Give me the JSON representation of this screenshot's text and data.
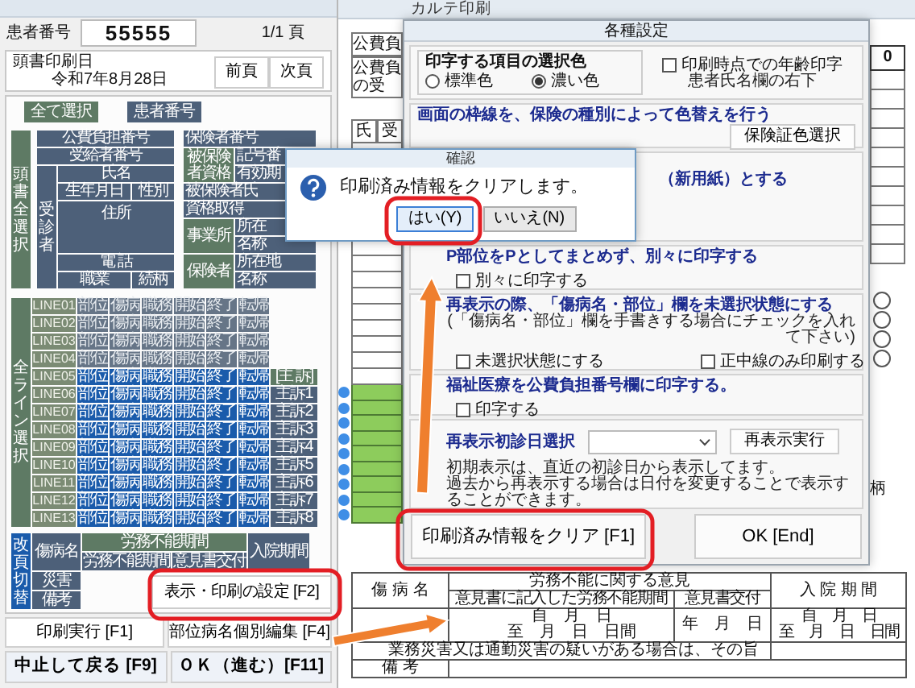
{
  "left_window": {
    "patient_label": "患者番号",
    "patient_number": "55555",
    "page": "1/1 頁",
    "print_date_label": "頭書印刷日",
    "print_date": "令和7年8月28日",
    "page_buttons": [
      "前頁",
      "次頁"
    ],
    "select_buttons": [
      {
        "label": "全て選択",
        "kind": "green"
      },
      {
        "label": "患者番号",
        "kind": "slate"
      }
    ],
    "header_group": {
      "label": "頭書全選択",
      "items": [
        {
          "text": "公費負担番号",
          "kind": "item"
        },
        {
          "text": "受給者番号",
          "kind": "item"
        },
        {
          "text": "受診者",
          "kind": "vertical"
        },
        {
          "text": "氏名",
          "kind": "item"
        },
        {
          "text": "生年月日",
          "kind": "item"
        },
        {
          "text": "性別",
          "kind": "item"
        },
        {
          "text": "住所",
          "kind": "item"
        },
        {
          "text": "電 話",
          "kind": "item"
        },
        {
          "text": "職業",
          "kind": "item"
        },
        {
          "text": "続柄",
          "kind": "item"
        },
        {
          "text": "保険者番号",
          "kind": "item"
        },
        {
          "text": "被保険者資格",
          "kind": "group"
        },
        {
          "text": "記号番",
          "kind": "item"
        },
        {
          "text": "有効期",
          "kind": "item"
        },
        {
          "text": "被保険者氏",
          "kind": "item"
        },
        {
          "text": "資格取得",
          "kind": "item"
        },
        {
          "text": "事業所",
          "kind": "group"
        },
        {
          "text": "所在",
          "kind": "item"
        },
        {
          "text": "名称",
          "kind": "item"
        },
        {
          "text": "保険者",
          "kind": "group"
        },
        {
          "text": "所在地",
          "kind": "item"
        },
        {
          "text": "名称",
          "kind": "item"
        }
      ]
    },
    "lines_group": {
      "label": "全ライン選択",
      "lines": [
        {
          "label": "LINE01",
          "selected": false,
          "cells": [
            "部位",
            "傷病",
            "職務",
            "開始",
            "終了",
            "転帰"
          ]
        },
        {
          "label": "LINE02",
          "selected": false,
          "cells": [
            "部位",
            "傷病",
            "職務",
            "開始",
            "終了",
            "転帰"
          ]
        },
        {
          "label": "LINE03",
          "selected": false,
          "cells": [
            "部位",
            "傷病",
            "職務",
            "開始",
            "終了",
            "転帰"
          ]
        },
        {
          "label": "LINE04",
          "selected": false,
          "cells": [
            "部位",
            "傷病",
            "職務",
            "開始",
            "終了",
            "転帰"
          ]
        },
        {
          "label": "LINE05",
          "selected": true,
          "cells": [
            "部位",
            "傷病",
            "職務",
            "開始",
            "終了",
            "転帰"
          ],
          "complaint": {
            "text": "[主 訴]",
            "kind": "group"
          }
        },
        {
          "label": "LINE06",
          "selected": true,
          "cells": [
            "部位",
            "傷病",
            "職務",
            "開始",
            "終了",
            "転帰"
          ],
          "complaint": {
            "text": "主訴1",
            "kind": "item"
          }
        },
        {
          "label": "LINE07",
          "selected": true,
          "cells": [
            "部位",
            "傷病",
            "職務",
            "開始",
            "終了",
            "転帰"
          ],
          "complaint": {
            "text": "主訴2",
            "kind": "item"
          }
        },
        {
          "label": "LINE08",
          "selected": true,
          "cells": [
            "部位",
            "傷病",
            "職務",
            "開始",
            "終了",
            "転帰"
          ],
          "complaint": {
            "text": "主訴3",
            "kind": "item"
          }
        },
        {
          "label": "LINE09",
          "selected": true,
          "cells": [
            "部位",
            "傷病",
            "職務",
            "開始",
            "終了",
            "転帰"
          ],
          "complaint": {
            "text": "主訴4",
            "kind": "item"
          }
        },
        {
          "label": "LINE10",
          "selected": true,
          "cells": [
            "部位",
            "傷病",
            "職務",
            "開始",
            "終了",
            "転帰"
          ],
          "complaint": {
            "text": "主訴5",
            "kind": "item"
          }
        },
        {
          "label": "LINE11",
          "selected": true,
          "cells": [
            "部位",
            "傷病",
            "職務",
            "開始",
            "終了",
            "転帰"
          ],
          "complaint": {
            "text": "主訴6",
            "kind": "item"
          }
        },
        {
          "label": "LINE12",
          "selected": true,
          "cells": [
            "部位",
            "傷病",
            "職務",
            "開始",
            "終了",
            "転帰"
          ],
          "complaint": {
            "text": "主訴7",
            "kind": "item"
          }
        },
        {
          "label": "LINE13",
          "selected": true,
          "cells": [
            "部位",
            "傷病",
            "職務",
            "開始",
            "終了",
            "転帰"
          ],
          "complaint": {
            "text": "主訴8",
            "kind": "item"
          }
        }
      ]
    },
    "page_break": {
      "label": "改頁切替",
      "selected": true
    },
    "bottom_items": [
      {
        "text": "傷病名",
        "kind": "item"
      },
      {
        "text": "災害",
        "kind": "item"
      },
      {
        "text": "備考",
        "kind": "item"
      },
      {
        "text": "労務不能期間",
        "kind": "group"
      },
      {
        "text": "労務不能期間",
        "kind": "item"
      },
      {
        "text": "意見書交付",
        "kind": "item"
      },
      {
        "text": "入院期間",
        "kind": "item"
      }
    ],
    "settings_button": "表示・印刷の設定 [F2]",
    "actions": [
      {
        "label": "印刷実行 [F1]",
        "kind": "plain"
      },
      {
        "label": "部位病名個別編集 [F4]",
        "kind": "plain"
      },
      {
        "label": "中止して戻る [F9]",
        "kind": "bold"
      },
      {
        "label": "ＯＫ（進む）[F11]",
        "kind": "bold"
      }
    ]
  },
  "preview": {
    "title": "カルテ印刷",
    "left_cells": [
      [
        "公費負"
      ],
      [
        "公費負",
        "の受"
      ]
    ],
    "side_cells": [
      "氏",
      "受"
    ],
    "right_value": "0",
    "right_label": "柄",
    "table": {
      "disease_header": "傷 病 名",
      "opinion_header": "労務不能に関する意見",
      "admission_header": "入 院 期 間",
      "opinion_columns": [
        "意見書に記入した労務不能期間",
        "意見書交付"
      ],
      "period": [
        "自　月　日",
        "至　月　日　日間"
      ],
      "issue_date": "年　月　日",
      "admission": [
        "自　月　日",
        "至　月　日　日間"
      ],
      "note": "業務災害又は通勤災害の疑いがある場合は、その旨",
      "remarks_label": "備 考"
    }
  },
  "settings": {
    "title": "各種設定",
    "color_group": {
      "label": "印字する項目の選択色",
      "options": [
        {
          "label": "標準色",
          "selected": false
        },
        {
          "label": "濃い色",
          "selected": true
        }
      ]
    },
    "age_option": {
      "label": "印刷時点での年齢印字",
      "checked": false,
      "note": "患者氏名欄の右下"
    },
    "sections": [
      {
        "kind": "button",
        "heading": "画面の枠線を、保険の種別によって色替えを行う",
        "button": "保険証色選択"
      },
      {
        "kind": "heading",
        "heading": "（新用紙）とする"
      },
      {
        "kind": "checks",
        "heading": "P部位をPとしてまとめず、別々に印字する",
        "options": [
          {
            "label": "別々に印字する",
            "checked": false
          }
        ]
      },
      {
        "kind": "checks",
        "heading": "再表示の際、「傷病名・部位」欄を未選択状態にする",
        "note": "(「傷病名・部位」欄を手書きする場合にチェックを入れて下さい)",
        "options": [
          {
            "label": "未選択状態にする",
            "checked": false
          },
          {
            "label": "正中線のみ印刷する",
            "checked": false
          }
        ]
      },
      {
        "kind": "checks",
        "heading": "福祉医療を公費負担番号欄に印字する。",
        "options": [
          {
            "label": "印字する",
            "checked": false
          }
        ]
      },
      {
        "kind": "date",
        "heading": "再表示初診日選択",
        "button": "再表示実行",
        "notes": [
          "初期表示は、直近の初診日から表示してます。",
          "過去から再表示する場合は日付を変更することで表示することができます。"
        ]
      }
    ],
    "buttons": [
      "印刷済み情報をクリア [F1]",
      "OK [End]"
    ]
  },
  "confirm": {
    "title": "確認",
    "message": "印刷済み情報をクリアします。",
    "buttons": [
      {
        "label": "はい(Y)",
        "focused": true
      },
      {
        "label": "いいえ(N)",
        "focused": false
      }
    ]
  }
}
